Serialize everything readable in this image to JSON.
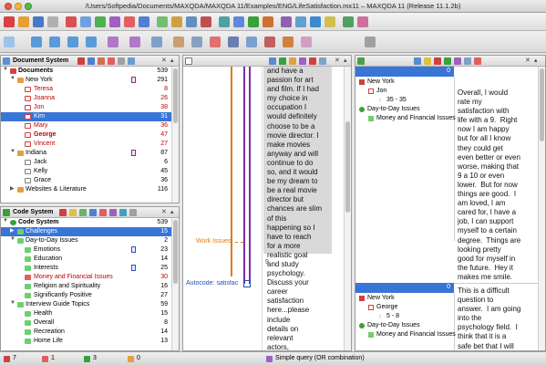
{
  "window": {
    "title": "/Users/Softpedia/Documents/MAXQDA/MAXQDA 11/Examples/ENG/LifeSatisfaction.mx11 – MAXQDA 11 (Release 11.1.2b)"
  },
  "document_system": {
    "title": "Document System",
    "items": [
      {
        "label": "Documents",
        "count": "539",
        "bold": true
      },
      {
        "label": "New York",
        "count": "291"
      },
      {
        "label": "Teresa",
        "count": "8",
        "red": true
      },
      {
        "label": "Joanna",
        "count": "26",
        "red": true
      },
      {
        "label": "Jon",
        "count": "38",
        "red": true
      },
      {
        "label": "Kim",
        "count": "31",
        "selected": true
      },
      {
        "label": "Mary",
        "count": "36",
        "red": true
      },
      {
        "label": "George",
        "count": "47",
        "red": true,
        "bold": true
      },
      {
        "label": "Vincent",
        "count": "27",
        "red": true
      },
      {
        "label": "Indiana",
        "count": "87"
      },
      {
        "label": "Jack",
        "count": "6"
      },
      {
        "label": "Kelly",
        "count": "45"
      },
      {
        "label": "Grace",
        "count": "36"
      },
      {
        "label": "Websites & Literature",
        "count": "116"
      }
    ]
  },
  "code_system": {
    "title": "Code System",
    "items": [
      {
        "label": "Code System",
        "count": "539",
        "bold": true
      },
      {
        "label": "Challenges",
        "count": "15",
        "selected": true
      },
      {
        "label": "Day-to-Day Issues",
        "count": "2"
      },
      {
        "label": "Emotions",
        "count": "23"
      },
      {
        "label": "Education",
        "count": "14"
      },
      {
        "label": "Interests",
        "count": "25"
      },
      {
        "label": "Money and Financial Issues",
        "count": "30",
        "red": true
      },
      {
        "label": "Religion and Spirituality",
        "count": "16"
      },
      {
        "label": "Significantly Positive",
        "count": "27"
      },
      {
        "label": "Interview Guide Topics",
        "count": "59"
      },
      {
        "label": "Health",
        "count": "15"
      },
      {
        "label": "Overall",
        "count": "8"
      },
      {
        "label": "Recreation",
        "count": "14"
      },
      {
        "label": "Home Life",
        "count": "13"
      }
    ]
  },
  "document_browser": {
    "margin_labels": {
      "work_issues": "Work Issues",
      "autocode": "Autocode: satisfac",
      "para_num": "9"
    },
    "text": "and have a\npassion for art\nand film. If I had\nmy choice in\noccupation I\nwould definitely\nchoose to be a\nmovie director. I\nmake movies\nanyway and will\ncontinue to do\nso, and it would\nbe my dream to\nbe a real movie\ndirector but\nchances are slim\nof this\nhappening so I\nhave to reach\nfor a more\nrealistic goal\nand study\npsychology.\nDiscuss your\ncareer\nsatisfaction\nhere...please\ninclude\ndetails on\nrelevant\nactors,\nactions,"
  },
  "retrieved": {
    "header_count": "0",
    "top_tree": [
      "New York",
      "Jon",
      "35 - 35",
      "Day-to-Day Issues",
      "Money and Financial Issues"
    ],
    "bottom_count": "0",
    "bottom_tree": [
      "New York",
      "George",
      "5 - 8",
      "Day-to-Day Issues",
      "Money and Financial Issues"
    ],
    "text_top": "Overall, I would\nrate my\nsatisfaction with\nlife with a 9.  Right\nnow I am happy\nbut for all I know\nthey could get\neven better or even\nworse, making that\n9 a 10 or even\nlower.  But for now\nthings are good.  I\nam loved, I am\ncared for, I have a\njob, I can support\nmyself to a certain\ndegree.  Things are\nlooking pretty\ngood for myself in\nthe future.  Hey it\nmakes me smile.",
    "text_bottom": "This is a difficult\nquestion to\nanswer.  I am going\ninto the\npsychology field.  I\nthink that it is a\nsafe bet that I will\nget a good job and"
  },
  "statusbar": {
    "items": [
      "7",
      "1",
      "3",
      "0"
    ],
    "query": "Simple query (OR combination)"
  },
  "colors": {
    "selection": "#3875d7",
    "memo": "#8a2a8a",
    "code_green": "#2aa52a",
    "doc_red": "#c00000"
  }
}
